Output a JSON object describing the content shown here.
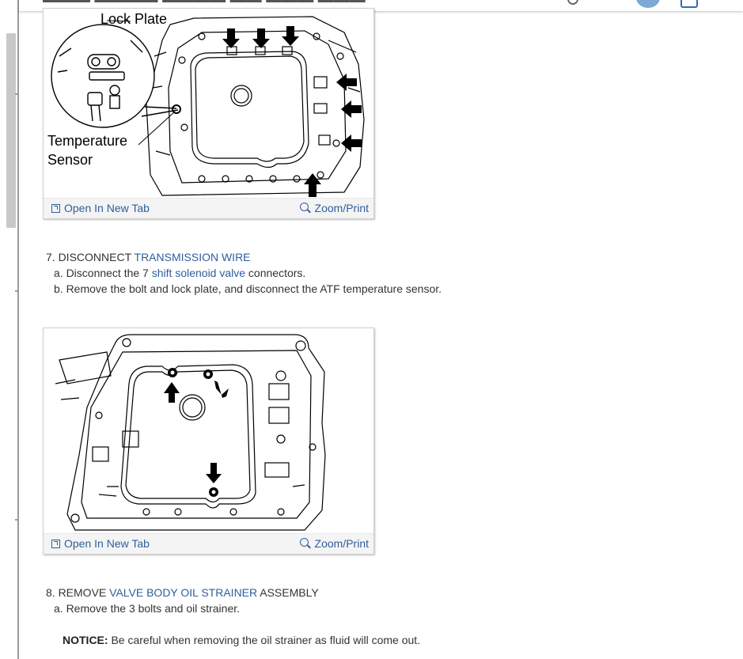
{
  "figure1": {
    "labels": {
      "lock_plate": "Lock Plate",
      "temperature": "Temperature",
      "sensor": "Sensor"
    },
    "open_label": "Open In New Tab",
    "zoom_label": "Zoom/Print"
  },
  "step7": {
    "prefix": "7. DISCONNECT ",
    "link": "TRANSMISSION WIRE",
    "a_prefix": "a. Disconnect the 7 ",
    "a_link": "shift solenoid valve",
    "a_suffix": " connectors.",
    "b": "b. Remove the bolt and lock plate, and disconnect the ATF temperature sensor."
  },
  "figure2": {
    "open_label": "Open In New Tab",
    "zoom_label": "Zoom/Print"
  },
  "step8": {
    "prefix": "8. REMOVE ",
    "link": "VALVE BODY OIL STRAINER",
    "suffix": " ASSEMBLY",
    "a": "a. Remove the 3 bolts and oil strainer."
  },
  "notice": {
    "label": "NOTICE:",
    "text": " Be careful when removing the oil strainer as fluid will come out."
  },
  "colors": {
    "link": "#2f5e9c",
    "text": "#333333",
    "footer_bg": "#f4f4f4"
  }
}
